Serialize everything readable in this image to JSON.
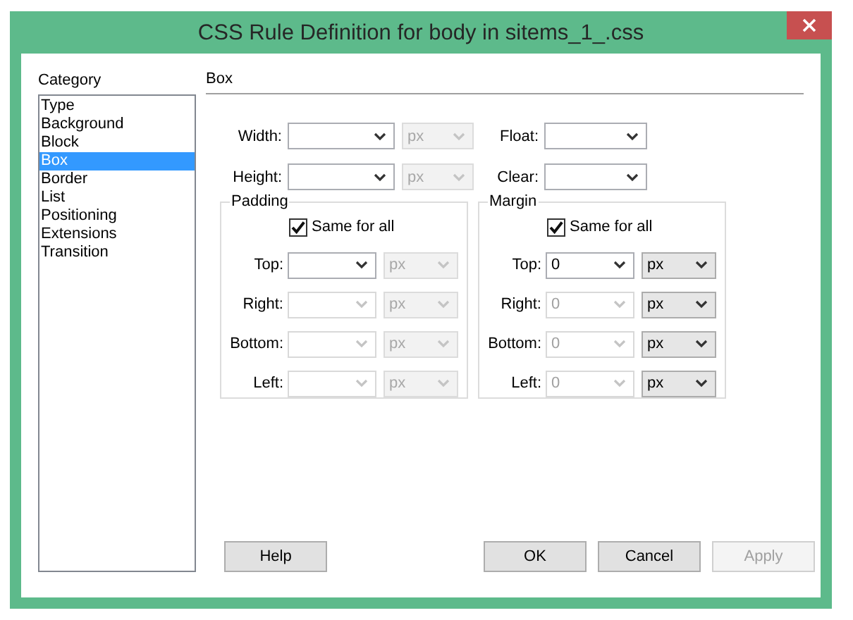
{
  "window": {
    "title": "CSS Rule Definition for body in sitems_1_.css"
  },
  "category": {
    "label": "Category",
    "items": [
      {
        "label": "Type",
        "selected": false
      },
      {
        "label": "Background",
        "selected": false
      },
      {
        "label": "Block",
        "selected": false
      },
      {
        "label": "Box",
        "selected": true
      },
      {
        "label": "Border",
        "selected": false
      },
      {
        "label": "List",
        "selected": false
      },
      {
        "label": "Positioning",
        "selected": false
      },
      {
        "label": "Extensions",
        "selected": false
      },
      {
        "label": "Transition",
        "selected": false
      }
    ]
  },
  "panel": {
    "title": "Box",
    "top_fields": [
      {
        "label": "Width:",
        "disabled": false,
        "unit": {
          "value": "px",
          "disabled": true
        }
      },
      {
        "label": "Float:",
        "disabled": false
      },
      {
        "label": "Height:",
        "disabled": false,
        "unit": {
          "value": "px",
          "disabled": true
        }
      },
      {
        "label": "Clear:",
        "disabled": false
      }
    ],
    "groups": [
      {
        "title": "Padding",
        "same_for_all": {
          "label": "Same for all",
          "checked": true
        },
        "fields": [
          {
            "label": "Top:",
            "disabled": false,
            "unit": {
              "value": "px",
              "disabled": true
            }
          },
          {
            "label": "Right:",
            "disabled": true,
            "unit": {
              "value": "px",
              "disabled": true
            }
          },
          {
            "label": "Bottom:",
            "disabled": true,
            "unit": {
              "value": "px",
              "disabled": true
            }
          },
          {
            "label": "Left:",
            "disabled": true,
            "unit": {
              "value": "px",
              "disabled": true
            }
          }
        ]
      },
      {
        "title": "Margin",
        "same_for_all": {
          "label": "Same for all",
          "checked": true
        },
        "fields": [
          {
            "label": "Top:",
            "value": "0",
            "disabled": false,
            "unit": {
              "value": "px",
              "disabled": false
            }
          },
          {
            "label": "Right:",
            "value": "0",
            "disabled": true,
            "unit": {
              "value": "px",
              "disabled": false
            }
          },
          {
            "label": "Bottom:",
            "value": "0",
            "disabled": true,
            "unit": {
              "value": "px",
              "disabled": false
            }
          },
          {
            "label": "Left:",
            "value": "0",
            "disabled": true,
            "unit": {
              "value": "px",
              "disabled": false
            }
          }
        ]
      }
    ]
  },
  "buttons": [
    {
      "label": "Help",
      "disabled": false
    },
    {
      "label": "OK",
      "disabled": false
    },
    {
      "label": "Cancel",
      "disabled": false
    },
    {
      "label": "Apply",
      "disabled": true
    }
  ]
}
